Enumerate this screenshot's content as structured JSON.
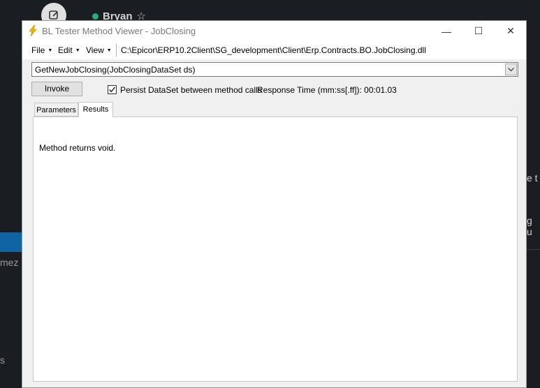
{
  "background": {
    "user_name": "Bryan",
    "left_fragments": [
      "mez",
      "s"
    ],
    "right_fragments": [
      "e t",
      "g u"
    ]
  },
  "window": {
    "title": "BL Tester Method Viewer - JobClosing",
    "controls": {
      "minimize": "—",
      "maximize": "☐",
      "close": "✕"
    }
  },
  "menu": {
    "items": [
      {
        "label": "File"
      },
      {
        "label": "Edit"
      },
      {
        "label": "View"
      }
    ],
    "path": "C:\\Epicor\\ERP10.2Client\\SG_development\\Client\\Erp.Contracts.BO.JobClosing.dll"
  },
  "method": {
    "selected": "GetNewJobClosing(JobClosingDataSet ds)"
  },
  "actions": {
    "invoke_label": "Invoke",
    "persist_label": "Persist DataSet between method calls",
    "persist_checked": true,
    "response_time_label": "Response Time (mm:ss[.ff]): 00:01.03"
  },
  "tabs": [
    {
      "label": "Parameters",
      "active": false
    },
    {
      "label": "Results",
      "active": true
    }
  ],
  "results": {
    "message": "Method returns void."
  }
}
